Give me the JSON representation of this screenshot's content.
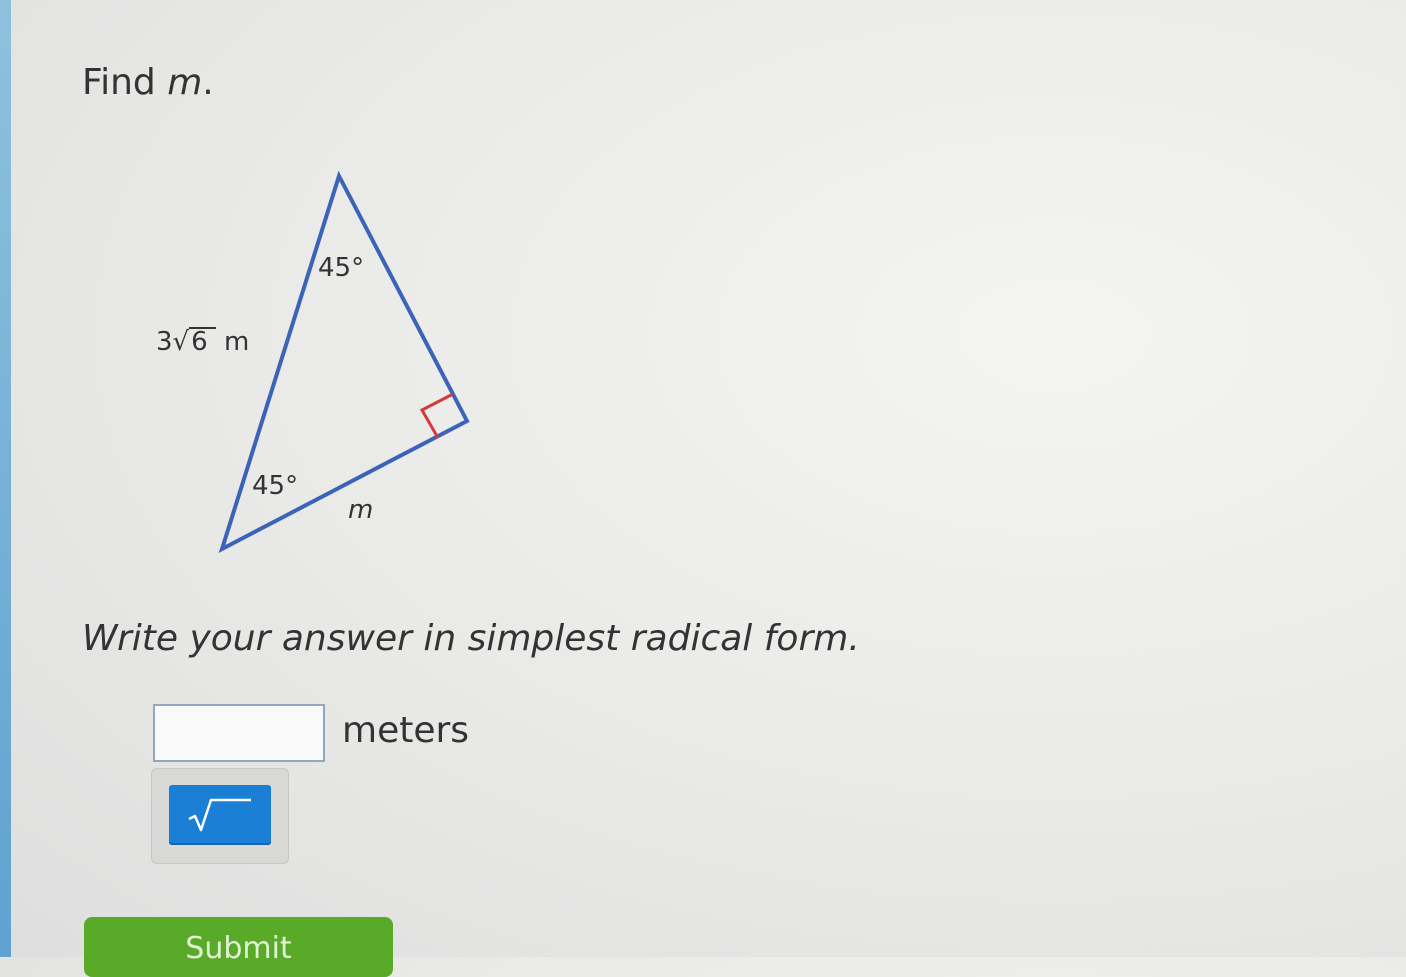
{
  "question": {
    "prompt_prefix": "Find",
    "prompt_variable": "m",
    "prompt_suffix": "."
  },
  "figure": {
    "hypotenuse_coefficient": "3",
    "hypotenuse_radicand": "6",
    "hypotenuse_unit": "m",
    "angle_top": "45°",
    "angle_bottom": "45°",
    "leg_label": "m",
    "colors": {
      "triangle": "#3b63b8",
      "right_angle_mark": "#d43a3a"
    }
  },
  "instruction": "Write your answer in simplest radical form.",
  "answer": {
    "value": "",
    "unit": "meters"
  },
  "tools": {
    "sqrt_icon": "square-root-icon",
    "button_color": "#1c7fd6"
  },
  "submit": {
    "label": "Submit",
    "color": "#5aaa2a"
  }
}
